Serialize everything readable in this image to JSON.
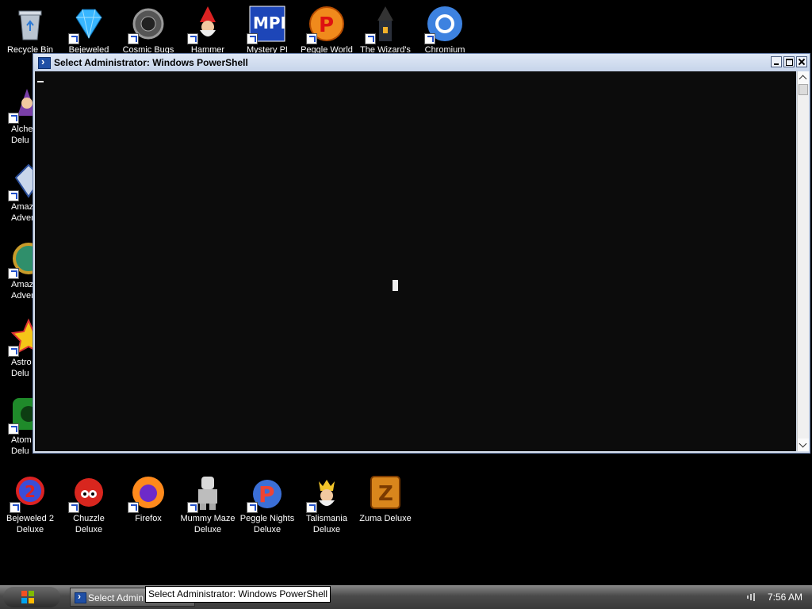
{
  "desktop_icons_top": [
    {
      "label": "Recycle Bin",
      "icon": "recycle-bin-icon"
    },
    {
      "label": "Bejeweled",
      "icon": "diamond-icon"
    },
    {
      "label": "Cosmic Bugs",
      "icon": "bug-icon"
    },
    {
      "label": "Hammer",
      "icon": "gnome-icon"
    },
    {
      "label": "Mystery PI",
      "icon": "mpi-icon"
    },
    {
      "label": "Peggle World",
      "icon": "peggle-icon"
    },
    {
      "label": "The Wizard's",
      "icon": "wizard-tower-icon"
    },
    {
      "label": "Chromium",
      "icon": "chromium-icon"
    }
  ],
  "desktop_icons_left": [
    {
      "label_line1": "Alche",
      "label_line2": "Delu",
      "icon": "alchemy-icon"
    },
    {
      "label_line1": "Amaz",
      "label_line2": "Adver",
      "icon": "amazing-adventures-icon"
    },
    {
      "label_line1": "Amaz",
      "label_line2": "Adventu",
      "icon": "globe-icon"
    },
    {
      "label_line1": "Astro",
      "label_line2": "Delu",
      "icon": "star-icon"
    },
    {
      "label_line1": "Atom",
      "label_line2": "Delu",
      "icon": "atom-icon"
    }
  ],
  "desktop_icons_bottom": [
    {
      "label_line1": "Bejeweled 2",
      "label_line2": "Deluxe",
      "icon": "bejeweled2-icon"
    },
    {
      "label_line1": "Chuzzle",
      "label_line2": "Deluxe",
      "icon": "chuzzle-icon"
    },
    {
      "label_line1": "Firefox",
      "label_line2": "",
      "icon": "firefox-icon"
    },
    {
      "label_line1": "Mummy Maze",
      "label_line2": "Deluxe",
      "icon": "mummy-icon"
    },
    {
      "label_line1": "Peggle Nights",
      "label_line2": "Deluxe",
      "icon": "peggle-nights-icon"
    },
    {
      "label_line1": "Talismania",
      "label_line2": "Deluxe",
      "icon": "talismania-icon"
    },
    {
      "label_line1": "Zuma Deluxe",
      "label_line2": "",
      "icon": "zuma-icon"
    }
  ],
  "window": {
    "title": "Select Administrator: Windows PowerShell"
  },
  "taskbar": {
    "task_label": "Select Admin",
    "tooltip": "Select Administrator: Windows PowerShell",
    "clock": "7:56 AM"
  }
}
